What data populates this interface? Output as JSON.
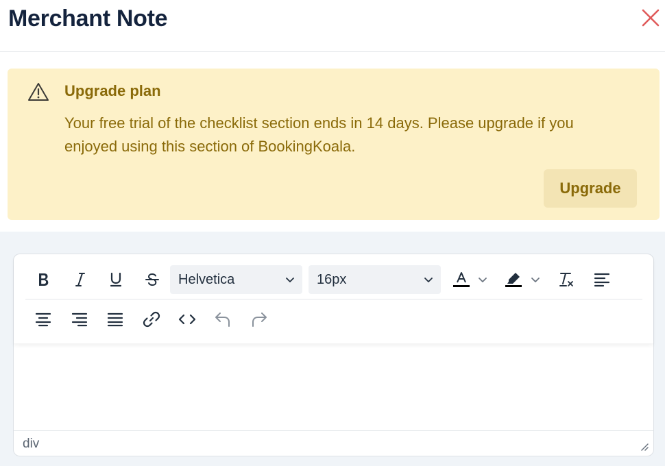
{
  "modal": {
    "title": "Merchant Note"
  },
  "alert": {
    "title": "Upgrade plan",
    "message": "Your free trial of the checklist section ends in 14 days. Please upgrade if you enjoyed using this section of BookingKoala.",
    "button_label": "Upgrade",
    "color": "#8a6a09",
    "background": "#fdf1c8"
  },
  "editor": {
    "font_family_value": "Helvetica",
    "font_size_value": "16px",
    "status_path": "div",
    "toolbar_icons": [
      "bold-icon",
      "italic-icon",
      "underline-icon",
      "strikethrough-icon",
      "text-color-icon",
      "highlight-icon",
      "clear-format-icon",
      "align-left-icon",
      "align-center-icon",
      "align-right-icon",
      "align-justify-icon",
      "link-icon",
      "code-icon",
      "undo-icon",
      "redo-icon"
    ]
  },
  "colors": {
    "close": "#e05a5a",
    "accent_bg": "#f0f4f8"
  }
}
